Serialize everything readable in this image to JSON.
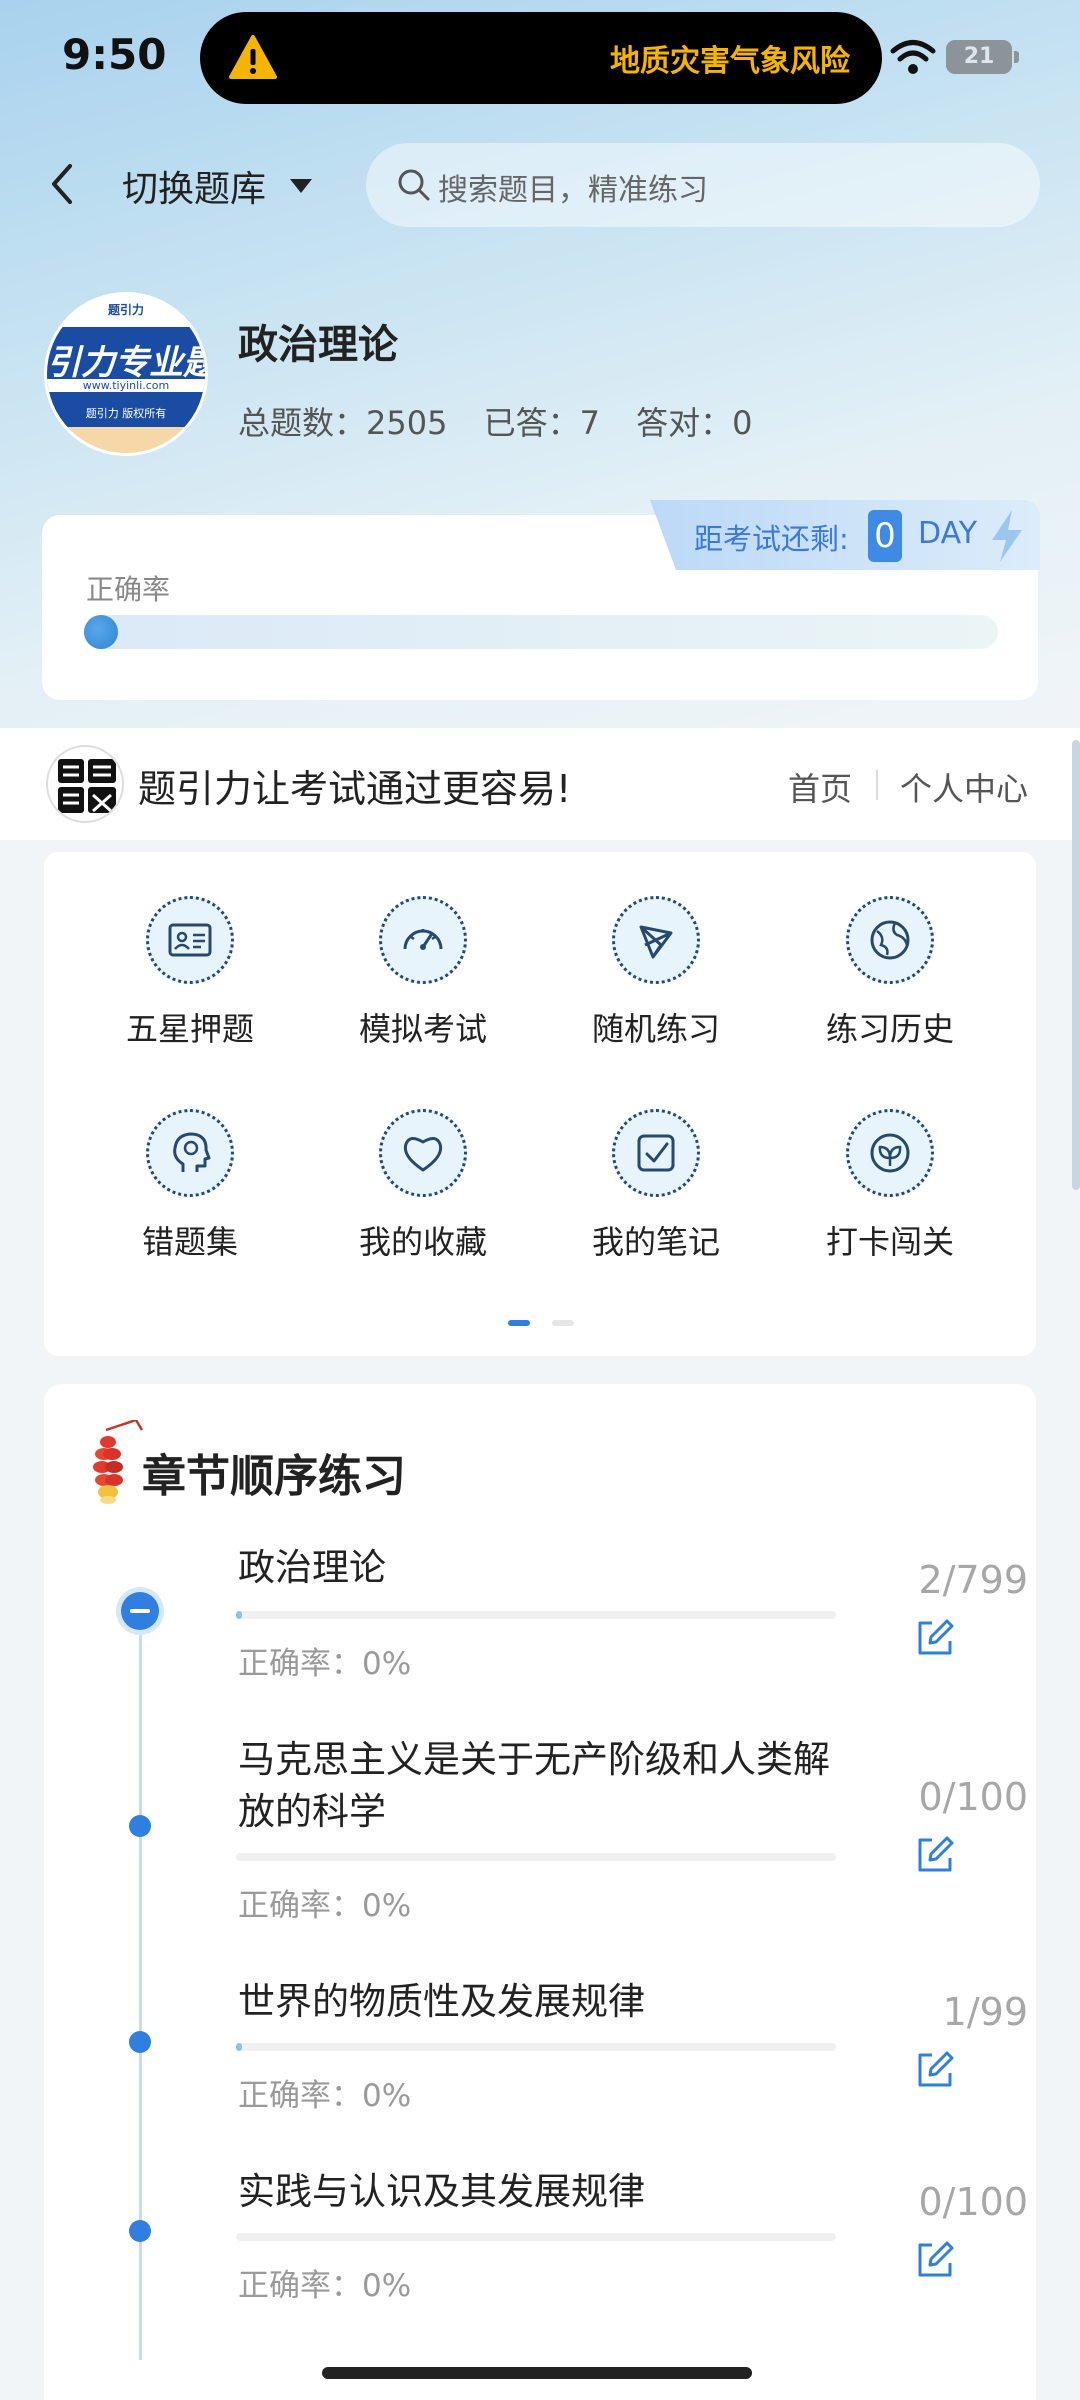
{
  "status_bar": {
    "time": "9:50",
    "alert_text": "地质灾害气象风险",
    "battery": "21"
  },
  "header": {
    "switch_label": "切换题库",
    "search_placeholder": "搜索题目，精准练习"
  },
  "profile": {
    "logo": {
      "brand": "引力专业题",
      "url": "www.tiyinli.com",
      "rights": "题引力 版权所有"
    },
    "subject": "政治理论",
    "total_label": "总题数：2505",
    "answered_label": "已答：7",
    "correct_label": "答对：0"
  },
  "accuracy": {
    "label": "正确率",
    "progress": 0,
    "countdown_label": "距考试还剩:",
    "countdown_value": "0",
    "countdown_unit": "DAY"
  },
  "banner": {
    "slogan": "题引力让考试通过更容易!",
    "nav_home": "首页",
    "nav_me": "个人中心"
  },
  "features": [
    {
      "label": "五星押题",
      "icon": "id-card-icon"
    },
    {
      "label": "模拟考试",
      "icon": "speedometer-icon"
    },
    {
      "label": "随机练习",
      "icon": "shuffle-icon"
    },
    {
      "label": "练习历史",
      "icon": "globe-icon"
    },
    {
      "label": "错题集",
      "icon": "head-icon"
    },
    {
      "label": "我的收藏",
      "icon": "heart-icon"
    },
    {
      "label": "我的笔记",
      "icon": "note-check-icon"
    },
    {
      "label": "打卡闯关",
      "icon": "leaf-badge-icon"
    }
  ],
  "chapters": {
    "title": "章节顺序练习",
    "items": [
      {
        "name": "政治理论",
        "count": "2/799",
        "accuracy": "正确率：0%",
        "progress": 0.003
      },
      {
        "name": "马克思主义是关于无产阶级和人类解放的科学",
        "count": "0/100",
        "accuracy": "正确率：0%",
        "progress": 0
      },
      {
        "name": "世界的物质性及发展规律",
        "count": "1/99",
        "accuracy": "正确率：0%",
        "progress": 0.01
      },
      {
        "name": "实践与认识及其发展规律",
        "count": "0/100",
        "accuracy": "正确率：0%",
        "progress": 0
      }
    ]
  },
  "colors": {
    "accent": "#2f7ee0",
    "alert": "#f5b400"
  }
}
